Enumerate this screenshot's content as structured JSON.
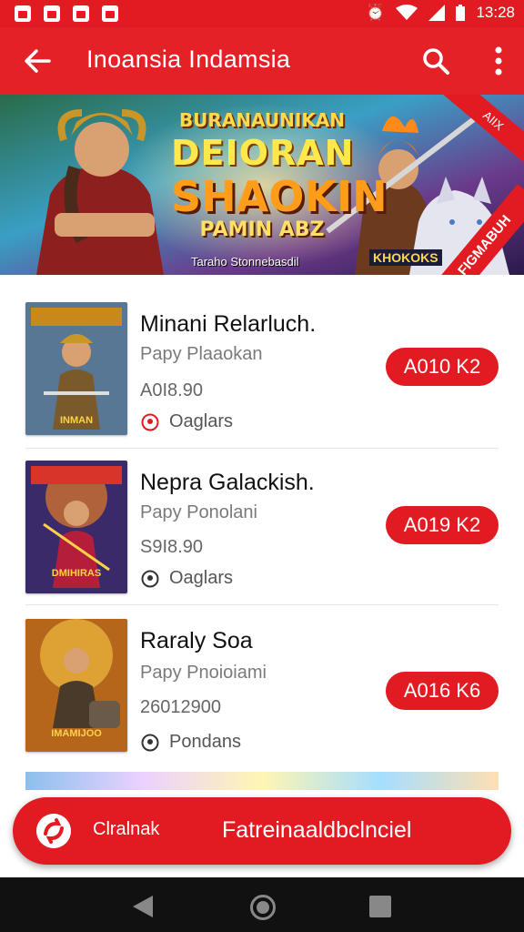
{
  "status_bar": {
    "time": "13:28"
  },
  "app_bar": {
    "title": "Inoansia Indamsia"
  },
  "banner": {
    "headline_1": "BURANAUNIKAN",
    "headline_2": "DEIORAN",
    "headline_3": "SHAOKIN",
    "headline_4": "PAMIN ABZ",
    "subtitle": "Taraho Stonnebasdil",
    "chip": "KHOKOKS",
    "ribbon_top": "AIIX",
    "ribbon_bottom": "FIGMABUH"
  },
  "items": [
    {
      "name": "Minani Relarluch.",
      "subtitle": "Papy Plaaokan",
      "price": "A0I8.90",
      "location": "Oaglars",
      "pill": "A010 K2",
      "thumb_caption": "INMAN"
    },
    {
      "name": "Nepra Galackish.",
      "subtitle": "Papy Ponolani",
      "price": "S9I8.90",
      "location": "Oaglars",
      "pill": "A019 K2",
      "thumb_caption": "DMIHIRAS"
    },
    {
      "name": "Raraly Soa",
      "subtitle": "Papy Pnoioiami",
      "price": "26012900",
      "location": "Pondans",
      "pill": "A016 K6",
      "thumb_caption": "IMAMIJOO"
    }
  ],
  "cta": {
    "left_label": "Clralnak",
    "right_label": "Fatreinaaldbclnciel"
  },
  "colors": {
    "brand_red": "#e21b23",
    "text_dark": "#111111",
    "text_grey": "#7a7a7a"
  },
  "icons": [
    "back-arrow-icon",
    "search-icon",
    "more-vert-icon",
    "location-pin-icon",
    "nav-back-icon",
    "nav-home-icon",
    "nav-recents-icon"
  ]
}
